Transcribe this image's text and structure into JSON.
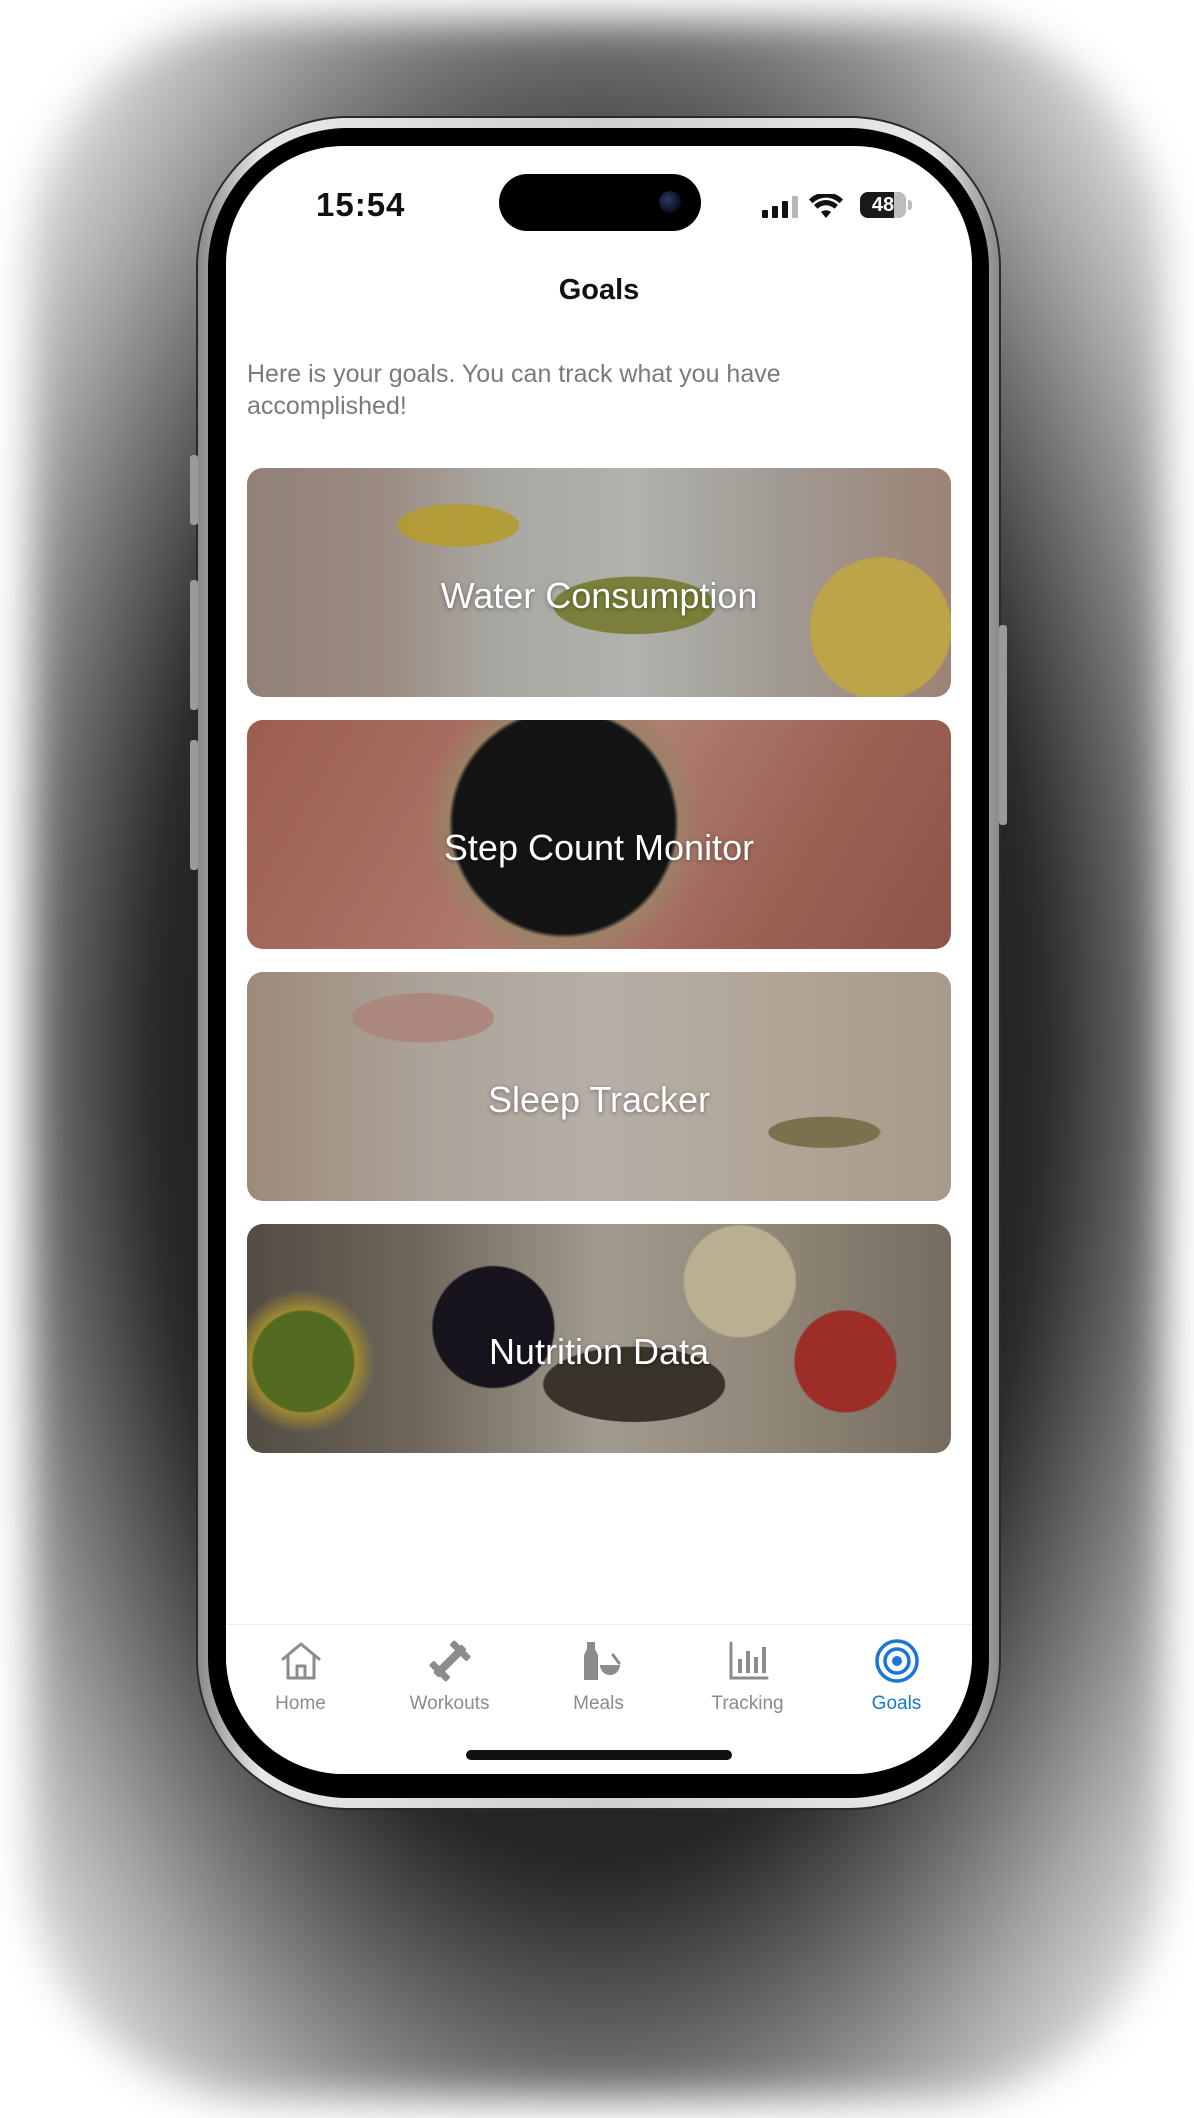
{
  "status_bar": {
    "time": "15:54",
    "battery": "48"
  },
  "page": {
    "title": "Goals",
    "intro": "Here is your goals. You can track what you have accomplished!"
  },
  "cards": [
    {
      "title": "Water Consumption"
    },
    {
      "title": "Step Count Monitor"
    },
    {
      "title": "Sleep Tracker"
    },
    {
      "title": "Nutrition Data"
    }
  ],
  "tabs": [
    {
      "label": "Home",
      "icon": "home-icon"
    },
    {
      "label": "Workouts",
      "icon": "dumbbell-icon"
    },
    {
      "label": "Meals",
      "icon": "meals-icon"
    },
    {
      "label": "Tracking",
      "icon": "bar-chart-icon"
    },
    {
      "label": "Goals",
      "icon": "target-icon",
      "active": true
    }
  ],
  "colors": {
    "accent": "#1877d6",
    "inactive_tab": "#8c8c8c",
    "intro_text": "#7a7a7a"
  }
}
